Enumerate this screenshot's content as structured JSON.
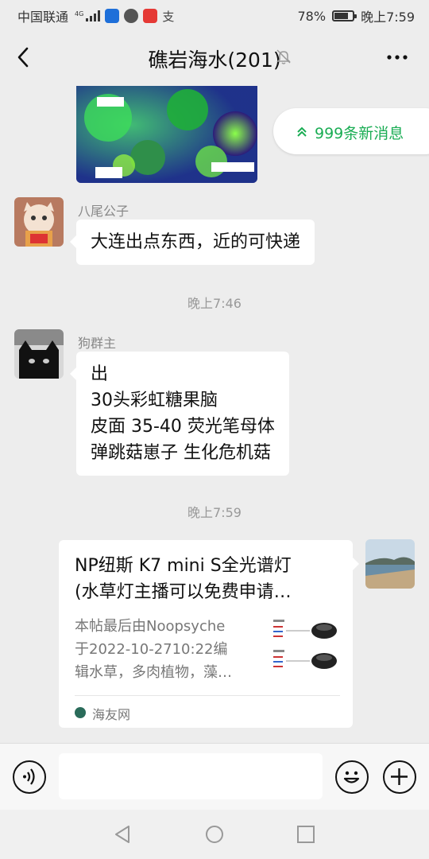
{
  "status_bar": {
    "carrier": "中国联通",
    "network": "4G",
    "battery_percent": "78%",
    "battery_level": 0.78,
    "time": "晚上7:59"
  },
  "header": {
    "title": "礁岩海水(201)",
    "back_icon": "chevron-left-icon",
    "mute_icon": "bell-muted-icon",
    "more_icon": "more-dots-icon"
  },
  "unread_pill": {
    "label": "999条新消息"
  },
  "messages": [
    {
      "sender": "八尾公子",
      "lines": [
        "大连出点东西，近的可快递"
      ]
    },
    {
      "time": "晚上7:46"
    },
    {
      "sender": "狗群主",
      "lines": [
        "出",
        "30头彩虹糖果脑",
        "皮面 35-40 荧光笔母体",
        "弹跳菇崽子 生化危机菇"
      ]
    },
    {
      "time": "晚上7:59"
    }
  ],
  "link_card": {
    "title_lines": [
      "NP纽斯 K7 mini S全光谱灯",
      "(水草灯主播可以免费申请…"
    ],
    "desc_lines": [
      "本帖最后由Noopsyche",
      "于2022-10-2710:22编",
      "辑水草，多肉植物，藻…"
    ],
    "source": "海友网"
  },
  "input_bar": {
    "voice_icon": "voice-icon",
    "emoji_icon": "emoji-icon",
    "plus_icon": "plus-icon",
    "value": ""
  },
  "colors": {
    "accent_green": "#1aad54",
    "chat_background": "#ededed",
    "bubble": "#ffffff"
  }
}
